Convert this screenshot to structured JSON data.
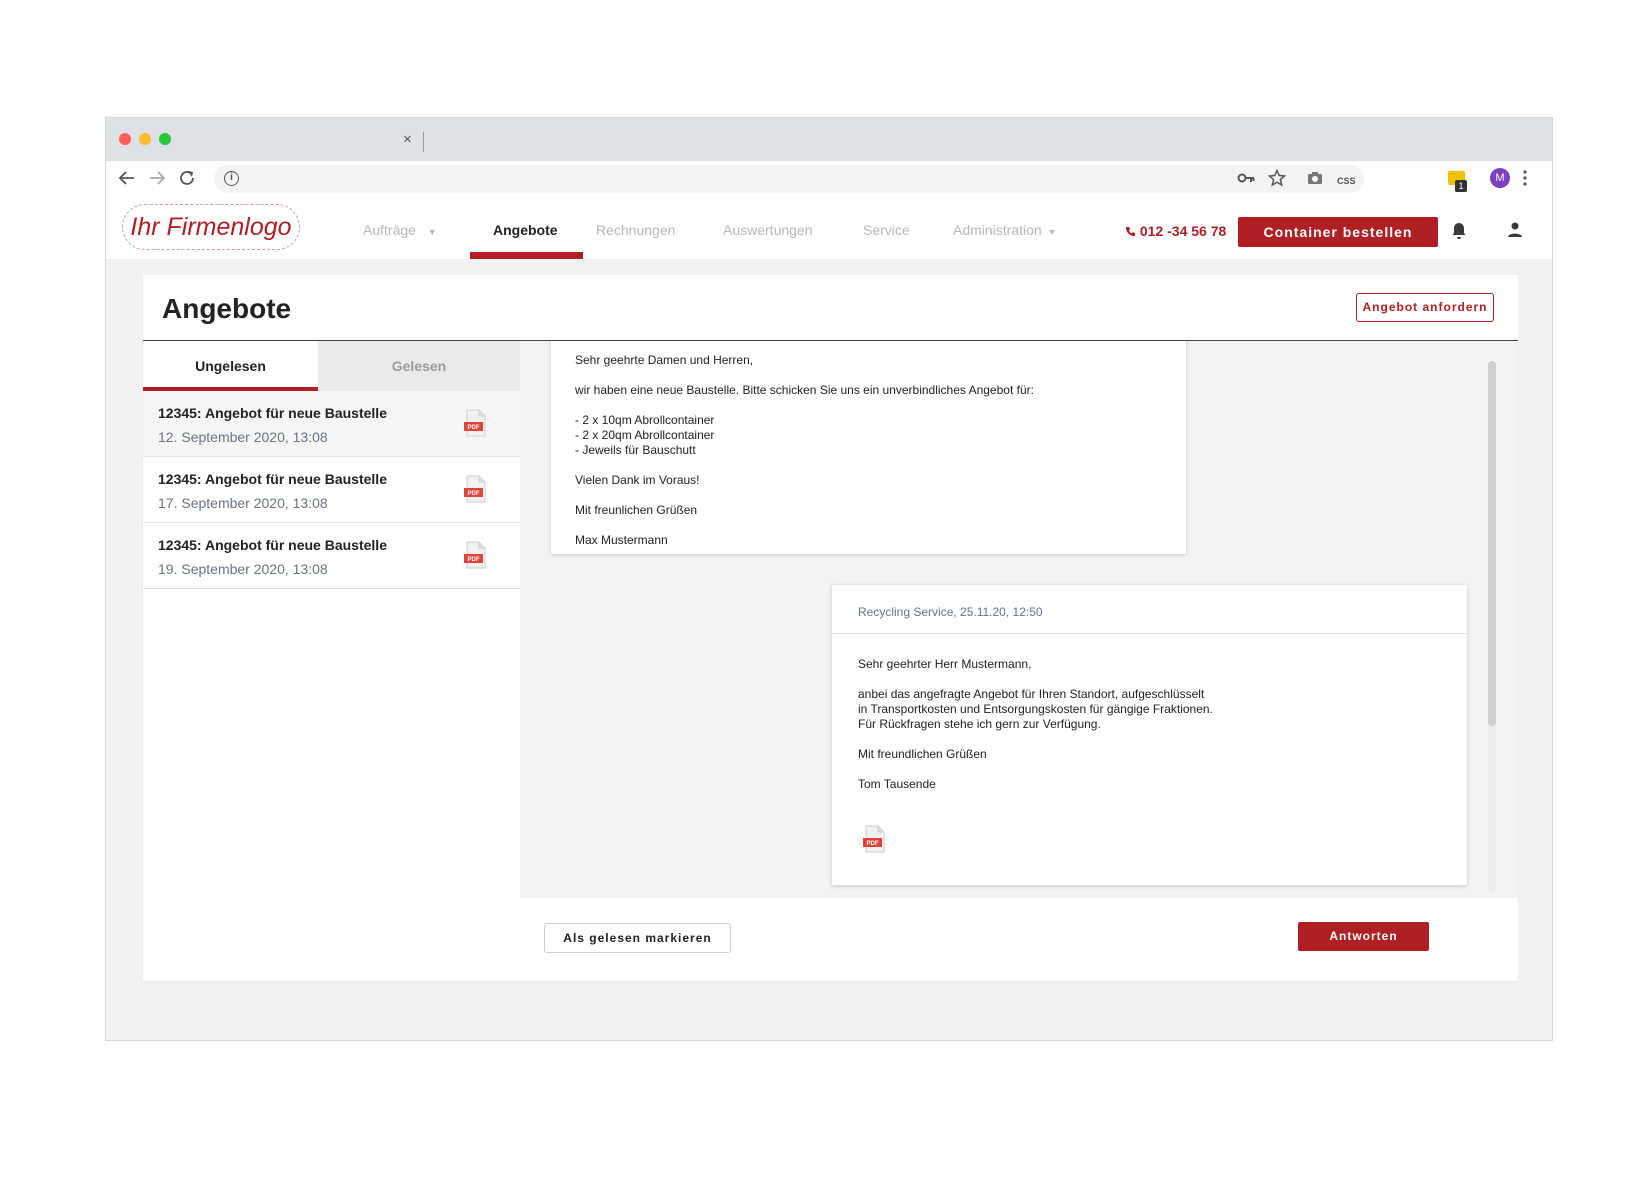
{
  "browser": {
    "tab_close": "×",
    "profile_initial": "M",
    "ext_badge": "1",
    "css_ext": "CSS"
  },
  "header": {
    "logo": "Ihr Firmenlogo",
    "nav": [
      {
        "label": "Aufträge",
        "caret": "▼"
      },
      {
        "label": "Angebote"
      },
      {
        "label": "Rechnungen"
      },
      {
        "label": "Auswertungen"
      },
      {
        "label": "Service"
      },
      {
        "label": "Administration",
        "caret": "▼"
      }
    ],
    "phone": "012 -34 56 78",
    "order_button": "Container bestellen"
  },
  "page": {
    "title": "Angebote",
    "request_button": "Angebot anfordern"
  },
  "tabs": {
    "unread": "Ungelesen",
    "read": "Gelesen"
  },
  "messages": [
    {
      "title": "12345: Angebot für neue Baustelle",
      "date": "12. September 2020, 13:08"
    },
    {
      "title": "12345: Angebot für neue Baustelle",
      "date": "17. September 2020, 13:08"
    },
    {
      "title": "12345: Angebot für neue Baustelle",
      "date": "19. September 2020, 13:08"
    }
  ],
  "conversation": {
    "request": {
      "lines": [
        "Sehr geehrte Damen und Herren,",
        "wir haben eine neue Baustelle. Bitte schicken Sie uns ein unverbindliches Angebot für:",
        "- 2 x 10qm Abrollcontainer",
        "- 2 x 20qm Abrollcontainer",
        "- Jeweils für Bauschutt",
        "Vielen Dank im Voraus!",
        "Mit freunlichen Grüßen",
        "Max Mustermann"
      ]
    },
    "reply": {
      "header": "Recycling Service,  25.11.20, 12:50",
      "lines": [
        "Sehr geehrter Herr Mustermann,",
        "anbei das angefragte Angebot für Ihren Standort, aufgeschlüsselt",
        "in Transportkosten und Entsorgungskosten für gängige Fraktionen.",
        "Für Rückfragen stehe ich gern zur Verfügung.",
        "Mit freundlichen Grüßen",
        "Tom Tausende"
      ]
    }
  },
  "footer": {
    "mark_read": "Als gelesen markieren",
    "reply": "Antworten"
  },
  "pdf_label": "PDF",
  "colors": {
    "brand": "#b01f24",
    "tab_inactive": "#e8eaec",
    "conversation_bg": "#f2f3f4"
  }
}
